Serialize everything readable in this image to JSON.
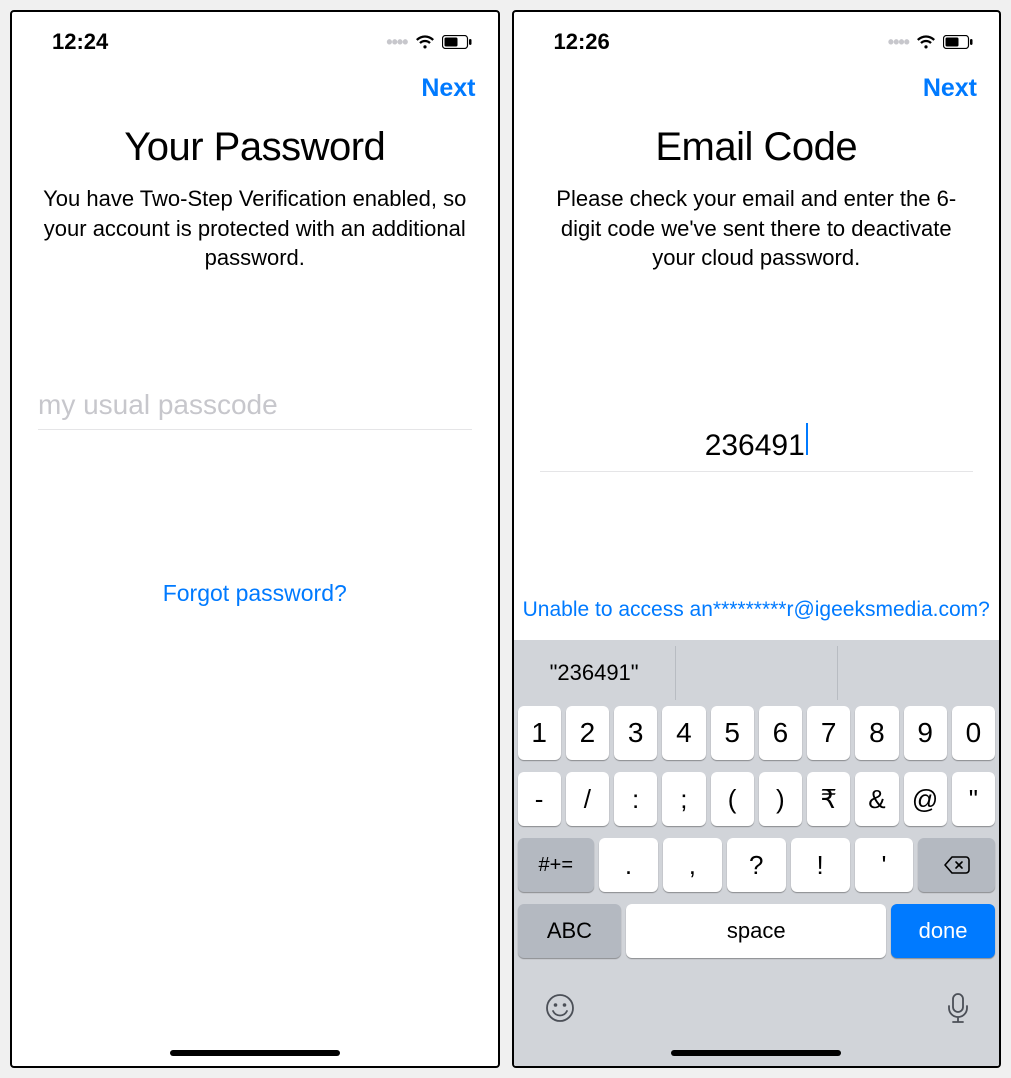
{
  "left": {
    "status": {
      "time": "12:24"
    },
    "nav": {
      "next_label": "Next"
    },
    "title": "Your Password",
    "subtitle": "You have Two-Step Verification enabled, so your account is protected with an additional password.",
    "input": {
      "placeholder": "my usual passcode",
      "value": ""
    },
    "forgot_label": "Forgot password?"
  },
  "right": {
    "status": {
      "time": "12:26"
    },
    "nav": {
      "next_label": "Next"
    },
    "title": "Email Code",
    "subtitle": "Please check your email and enter the 6-digit code we've sent there to deactivate your cloud password.",
    "input": {
      "value": "236491"
    },
    "unable_label": "Unable to access an*********r@igeeksmedia.com?",
    "keyboard": {
      "suggestion": "\"236491\"",
      "row1": [
        "1",
        "2",
        "3",
        "4",
        "5",
        "6",
        "7",
        "8",
        "9",
        "0"
      ],
      "row2": [
        "-",
        "/",
        ":",
        ";",
        "(",
        ")",
        "₹",
        "&",
        "@",
        "\""
      ],
      "row3_shift": "#+=",
      "row3_keys": [
        ".",
        ",",
        "?",
        "!",
        "'"
      ],
      "abc": "ABC",
      "space": "space",
      "done": "done"
    }
  }
}
